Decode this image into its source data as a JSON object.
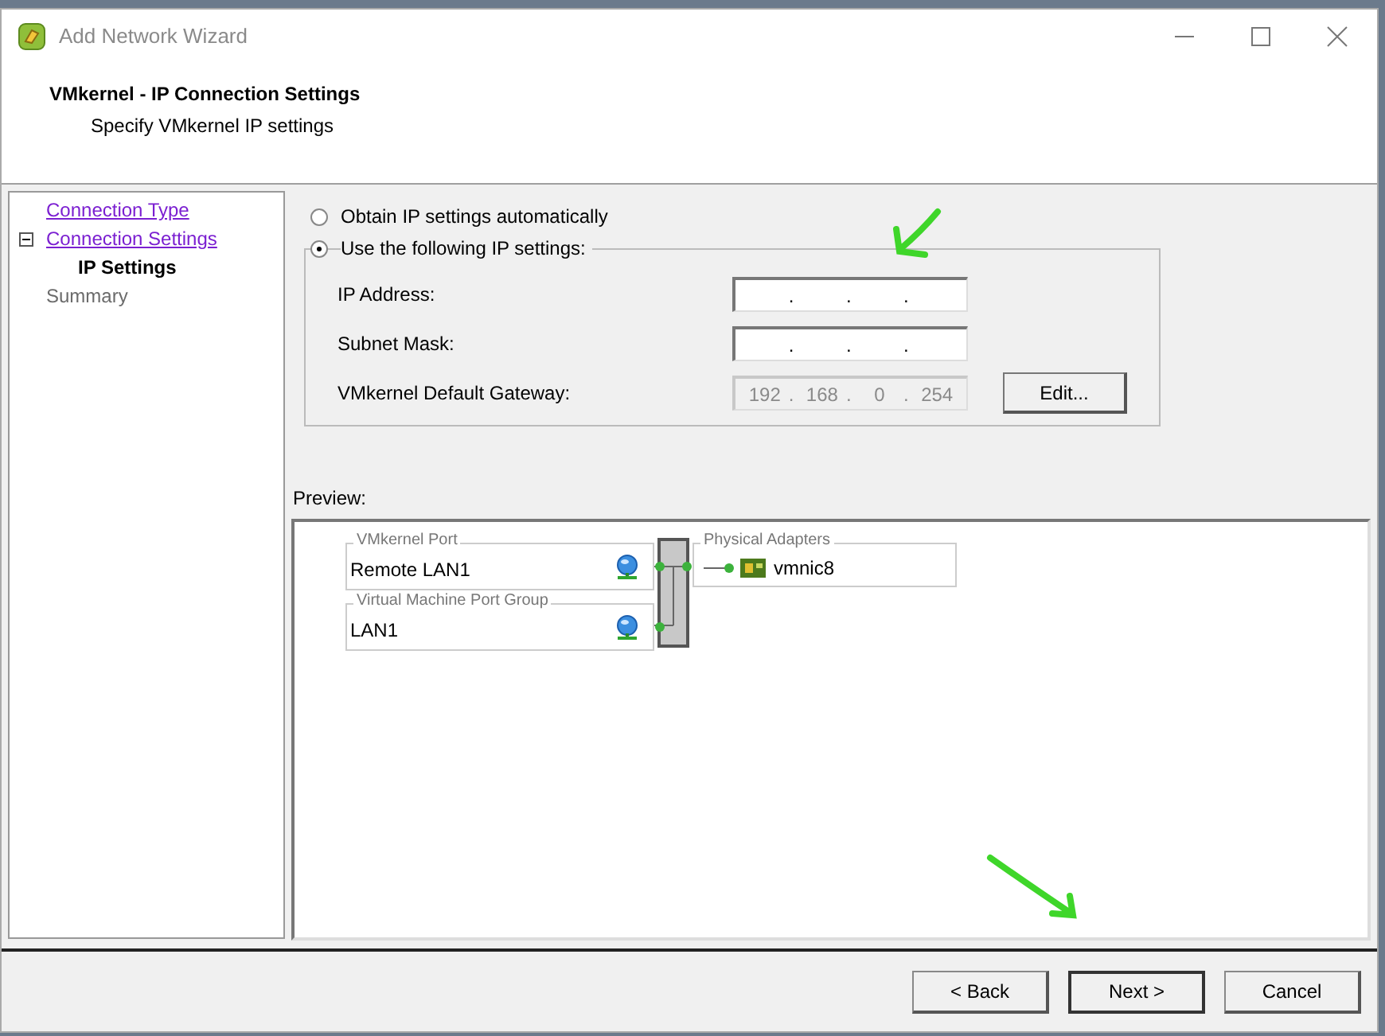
{
  "window": {
    "title": "Add Network Wizard"
  },
  "header": {
    "title": "VMkernel - IP Connection Settings",
    "subtitle": "Specify VMkernel IP settings"
  },
  "nav": [
    {
      "label": "Connection Type",
      "kind": "visited"
    },
    {
      "label": "Connection Settings",
      "kind": "visited",
      "expanded": true,
      "children": [
        {
          "label": "IP Settings",
          "kind": "current"
        }
      ]
    },
    {
      "label": "Summary",
      "kind": "pending"
    }
  ],
  "ip_mode": [
    {
      "label": "Obtain IP settings automatically",
      "selected": false
    },
    {
      "label": "Use the following IP settings:",
      "selected": true
    }
  ],
  "fields": [
    {
      "label": "IP Address:",
      "disabled": false,
      "separators": [
        ".",
        ".",
        "."
      ]
    },
    {
      "label": "Subnet Mask:",
      "disabled": false,
      "separators": [
        ".",
        ".",
        "."
      ]
    },
    {
      "label": "VMkernel Default Gateway:",
      "disabled": true,
      "octets": [
        "192",
        "168",
        "0",
        "254"
      ],
      "separators": [
        ".",
        ".",
        "."
      ]
    }
  ],
  "edit_button": "Edit...",
  "preview": {
    "label": "Preview:",
    "port_groups": [
      {
        "group_title": "VMkernel Port",
        "name": "Remote LAN1"
      },
      {
        "group_title": "Virtual Machine Port Group",
        "name": "LAN1"
      }
    ],
    "adapters": {
      "title": "Physical Adapters",
      "items": [
        "vmnic8"
      ]
    }
  },
  "buttons": [
    {
      "label": "< Back",
      "default": false
    },
    {
      "label": "Next >",
      "default": true
    },
    {
      "label": "Cancel",
      "default": false
    }
  ]
}
